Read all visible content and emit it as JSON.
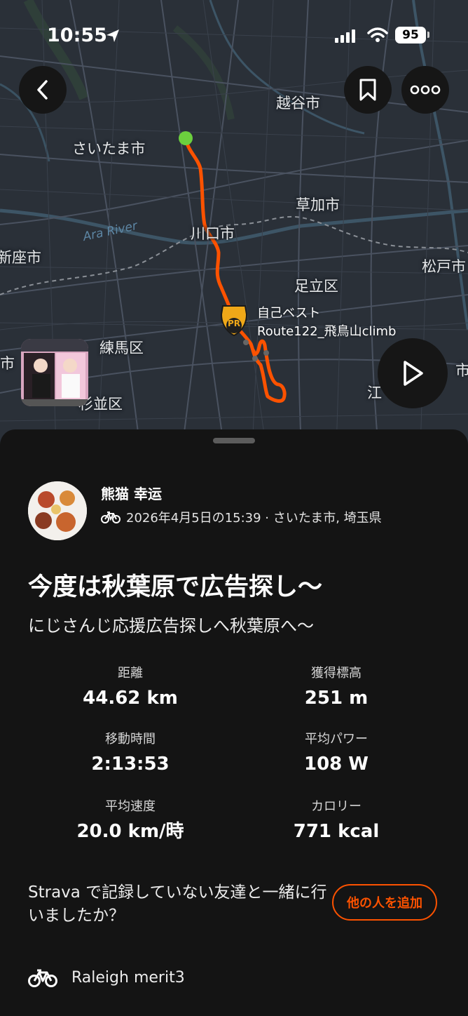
{
  "status_bar": {
    "time": "10:55",
    "battery": "95"
  },
  "map": {
    "city_labels": [
      "越谷市",
      "さいたま市",
      "草加市",
      "川口市",
      "足立区",
      "新座市",
      "松戸市",
      "練馬区",
      "杉並区",
      "江",
      "市",
      "市"
    ],
    "river_label": "Ara River",
    "pr_badge": "PR",
    "pr_caption": "自己ベスト",
    "pr_segment": "Route122_飛鳥山climb",
    "route_color": "#fc5200",
    "start_color": "#6ccf3e"
  },
  "buttons": {
    "back": "back-icon",
    "bookmark": "bookmark-icon",
    "more": "more-icon",
    "play": "play-icon"
  },
  "activity": {
    "athlete_name": "熊猫 幸运",
    "meta": "2026年4月5日の15:39 · さいたま市, 埼玉県",
    "title": "今度は秋葉原で広告探し〜",
    "description": "にじさんじ応援広告探しへ秋葉原へ〜"
  },
  "stats": [
    {
      "label": "距離",
      "value": "44.62 km"
    },
    {
      "label": "獲得標高",
      "value": "251 m"
    },
    {
      "label": "移動時間",
      "value": "2:13:53"
    },
    {
      "label": "平均パワー",
      "value": "108 W"
    },
    {
      "label": "平均速度",
      "value": "20.0 km/時"
    },
    {
      "label": "カロリー",
      "value": "771 kcal"
    }
  ],
  "friends": {
    "question": "Strava で記録していない友達と一緒に行いましたか？",
    "add_button": "他の人を追加"
  },
  "gear": {
    "name": "Raleigh merit3"
  },
  "colors": {
    "accent": "#fc5200",
    "background": "#141414",
    "map_bg": "#2a3038"
  }
}
